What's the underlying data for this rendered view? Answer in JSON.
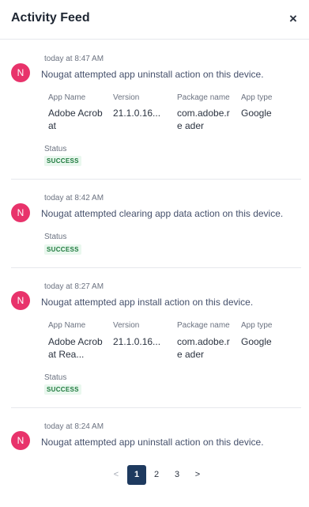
{
  "header": {
    "title": "Activity Feed",
    "close_symbol": "×"
  },
  "columns": {
    "app_name": "App Name",
    "version": "Version",
    "package_name": "Package name",
    "app_type": "App type"
  },
  "status_label": "Status",
  "items": [
    {
      "time": "today at 8:47 AM",
      "avatar": "N",
      "actor": "Nougat",
      "action": "attempted app uninstall action on this device.",
      "app_name": "Adobe Acrob at",
      "version": "21.1.0.16...",
      "package_name": "com.adobe.re ader",
      "app_type": "Google",
      "status": "SUCCESS"
    },
    {
      "time": "today at 8:42 AM",
      "avatar": "N",
      "actor": "Nougat",
      "action": "attempted clearing app data action on this device.",
      "status": "SUCCESS"
    },
    {
      "time": "today at 8:27 AM",
      "avatar": "N",
      "actor": "Nougat",
      "action": "attempted app install action on this device.",
      "app_name": "Adobe Acrob at Rea...",
      "version": "21.1.0.16...",
      "package_name": "com.adobe.re ader",
      "app_type": "Google",
      "status": "SUCCESS"
    },
    {
      "time": "today at 8:24 AM",
      "avatar": "N",
      "actor": "Nougat",
      "action": "attempted app uninstall action on this device."
    }
  ],
  "pagination": {
    "prev": "<",
    "pages": [
      "1",
      "2",
      "3"
    ],
    "current": "1",
    "next": ">"
  },
  "colors": {
    "avatar": "#e8336b",
    "active_page": "#1e3a5f",
    "success_bg": "#e9f7ee",
    "success_text": "#1c7a3c"
  }
}
